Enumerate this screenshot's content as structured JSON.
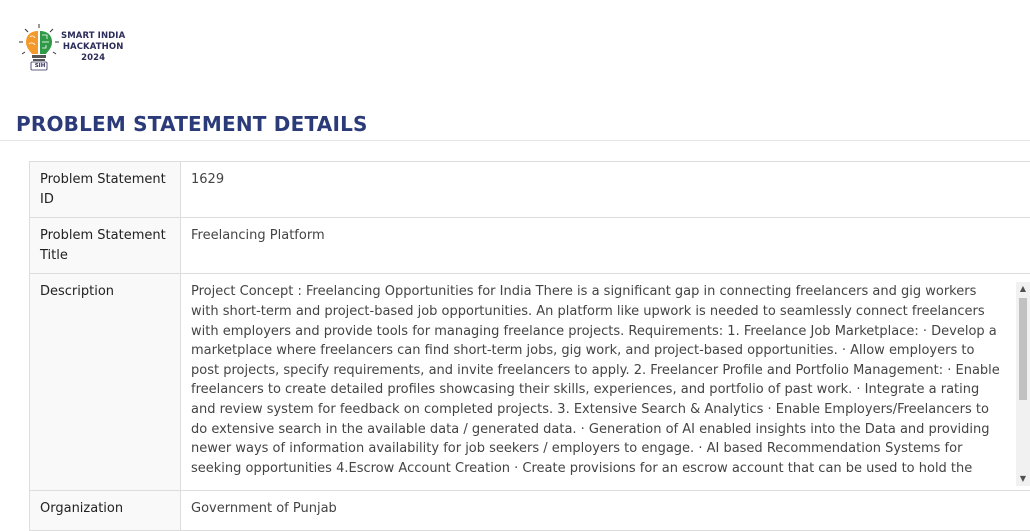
{
  "logo": {
    "line1": "SMART INDIA",
    "line2": "HACKATHON",
    "line3": "2024",
    "badge": "SIH"
  },
  "page_title": "PROBLEM STATEMENT DETAILS",
  "rows": [
    {
      "label": "Problem Statement ID",
      "value": "1629"
    },
    {
      "label": "Problem Statement Title",
      "value": "Freelancing Platform"
    },
    {
      "label": "Description",
      "value": "Project Concept : Freelancing Opportunities for India There is a significant gap in connecting freelancers and gig workers with short-term and project-based job opportunities. An platform like upwork is needed to seamlessly connect freelancers with employers and provide tools for managing freelance projects. Requirements: 1. Freelance Job Marketplace: · Develop a marketplace where freelancers can find short-term jobs, gig work, and project-based opportunities. · Allow employers to post projects, specify requirements, and invite freelancers to apply. 2. Freelancer Profile and Portfolio Management: · Enable freelancers to create detailed profiles showcasing their skills, experiences, and portfolio of past work. · Integrate a rating and review system for feedback on completed projects. 3. Extensive Search & Analytics · Enable Employers/Freelancers to do extensive search in the available data / generated data. · Generation of AI enabled insights into the Data and providing newer ways of information availability for job seekers / employers to engage. · AI based Recommendation Systems for seeking opportunities 4.Escrow Account Creation · Create provisions for an escrow account that can be used to hold the money until the job is fully delivered. Integrate secure payment gateways to facilitate smooth financial transactions between employers and freelancers."
    },
    {
      "label": "Organization",
      "value": "Government of Punjab"
    }
  ],
  "colors": {
    "title": "#2b3a78",
    "label_bg": "#f9f9f9",
    "border": "#dddddd",
    "logo_orange": "#f39a2b",
    "logo_green": "#2e9a47"
  }
}
